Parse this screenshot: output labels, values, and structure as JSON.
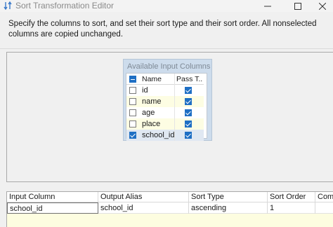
{
  "window": {
    "title": "Sort Transformation Editor",
    "icon": "sort-transform-icon",
    "controls": [
      "minimize-icon",
      "maximize-icon",
      "close-icon"
    ]
  },
  "instructions": "Specify the columns to sort, and set their sort type and their sort order. All nonselected columns are copied unchanged.",
  "available_columns": {
    "header": "Available Input Columns",
    "col_name": "Name",
    "col_pass": "Pass T...",
    "select_all_state": "indeterminate",
    "rows": [
      {
        "name": "id",
        "selected": false,
        "pass_through": true
      },
      {
        "name": "name",
        "selected": false,
        "pass_through": true
      },
      {
        "name": "age",
        "selected": false,
        "pass_through": true
      },
      {
        "name": "place",
        "selected": false,
        "pass_through": true
      },
      {
        "name": "school_id",
        "selected": true,
        "pass_through": true
      }
    ]
  },
  "sort_grid": {
    "headers": [
      "Input Column",
      "Output Alias",
      "Sort Type",
      "Sort Order",
      "Com"
    ],
    "rows": [
      {
        "input_column": "school_id",
        "output_alias": "school_id",
        "sort_type": "ascending",
        "sort_order": "1",
        "comparison": ""
      }
    ]
  },
  "colors": {
    "accent": "#1f6fc4",
    "panel": "#cddcec",
    "row_alt": "#fdfde3"
  }
}
